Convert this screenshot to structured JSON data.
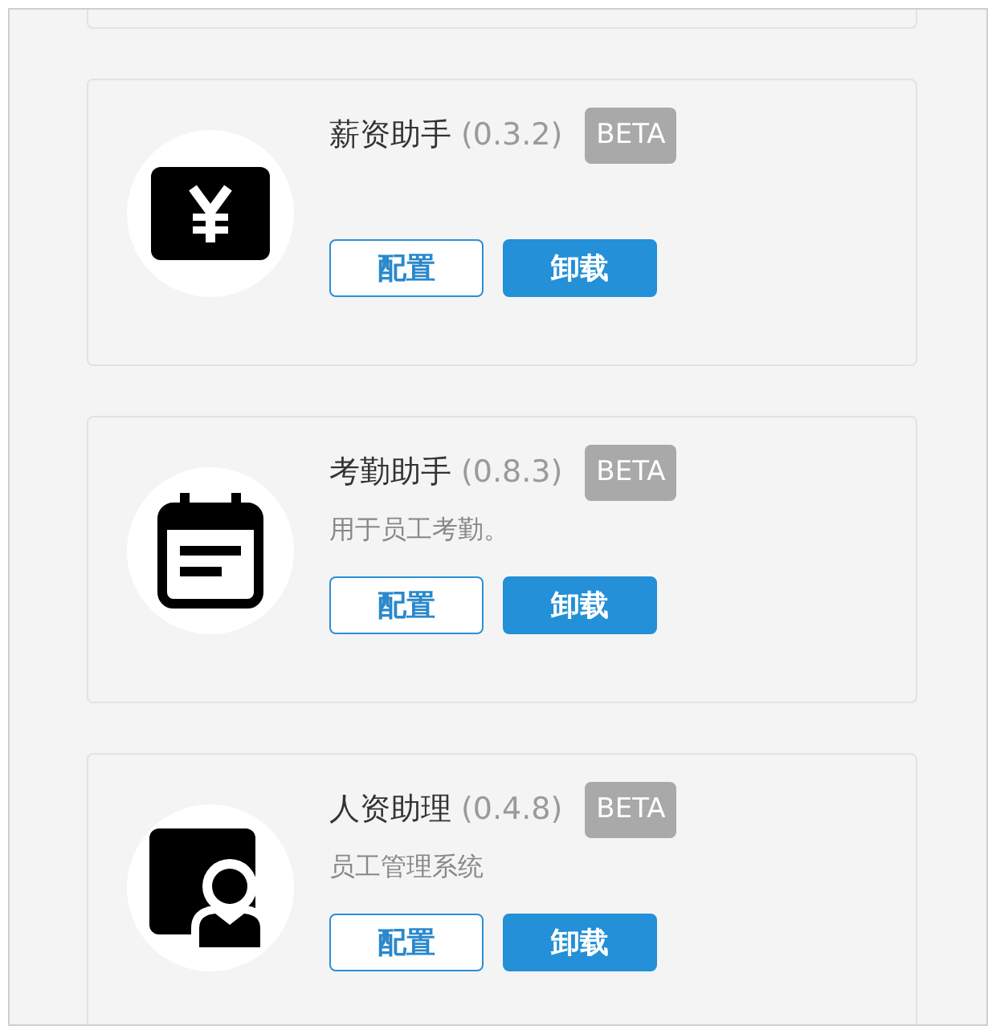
{
  "plugins": [
    {
      "kind": "yen",
      "name": "薪资助手",
      "version": "(0.3.2)",
      "badge": "BETA",
      "buttons": [
        {
          "label": "配置",
          "kind": "outline"
        },
        {
          "label": "卸载",
          "kind": "primary"
        }
      ]
    },
    {
      "kind": "calendar",
      "name": "考勤助手",
      "version": "(0.8.3)",
      "badge": "BETA",
      "description": "用于员工考勤。",
      "buttons": [
        {
          "label": "配置",
          "kind": "outline"
        },
        {
          "label": "卸载",
          "kind": "primary"
        }
      ]
    },
    {
      "kind": "person",
      "name": "人资助理",
      "version": "(0.4.8)",
      "badge": "BETA",
      "description": "员工管理系统",
      "buttons": [
        {
          "label": "配置",
          "kind": "outline"
        },
        {
          "label": "卸载",
          "kind": "primary"
        }
      ]
    }
  ]
}
